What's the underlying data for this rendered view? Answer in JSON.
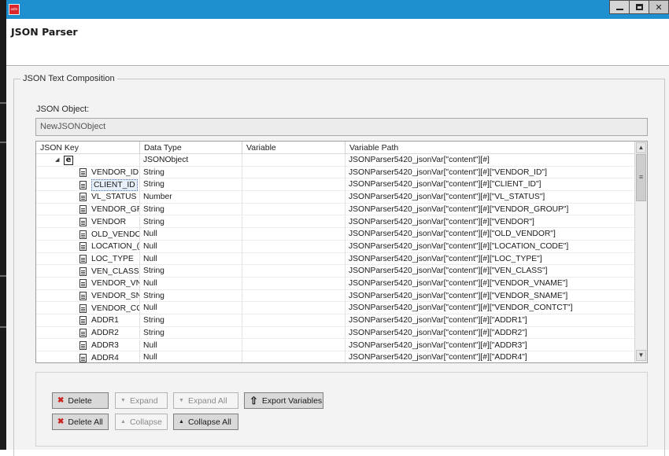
{
  "window": {
    "app_icon_text": "adm",
    "title": "JSON Parser",
    "controls": {
      "minimize": "▁",
      "maximize": "□",
      "close": ""
    }
  },
  "group": {
    "legend": "JSON Text Composition",
    "object_label": "JSON Object:",
    "object_value": "NewJSONObject"
  },
  "table": {
    "columns": [
      "JSON Key",
      "Data Type",
      "Variable",
      "Variable Path"
    ],
    "root": {
      "icon_text": "e",
      "expander": "◢",
      "type": "JSONObject",
      "variable": "",
      "path": "JSONParser5420_jsonVar[\"content\"][#]"
    },
    "rows": [
      {
        "key": "VENDOR_ID",
        "type": "String",
        "variable": "",
        "path": "JSONParser5420_jsonVar[\"content\"][#][\"VENDOR_ID\"]"
      },
      {
        "key": "CLIENT_ID",
        "type": "String",
        "variable": "",
        "path": "JSONParser5420_jsonVar[\"content\"][#][\"CLIENT_ID\"]"
      },
      {
        "key": "VL_STATUS",
        "type": "Number",
        "variable": "",
        "path": "JSONParser5420_jsonVar[\"content\"][#][\"VL_STATUS\"]"
      },
      {
        "key": "VENDOR_GR(",
        "type": "String",
        "variable": "",
        "path": "JSONParser5420_jsonVar[\"content\"][#][\"VENDOR_GROUP\"]"
      },
      {
        "key": "VENDOR",
        "type": "String",
        "variable": "",
        "path": "JSONParser5420_jsonVar[\"content\"][#][\"VENDOR\"]"
      },
      {
        "key": "OLD_VENDO",
        "type": "Null",
        "variable": "",
        "path": "JSONParser5420_jsonVar[\"content\"][#][\"OLD_VENDOR\"]"
      },
      {
        "key": "LOCATION_(",
        "type": "Null",
        "variable": "",
        "path": "JSONParser5420_jsonVar[\"content\"][#][\"LOCATION_CODE\"]"
      },
      {
        "key": "LOC_TYPE",
        "type": "Null",
        "variable": "",
        "path": "JSONParser5420_jsonVar[\"content\"][#][\"LOC_TYPE\"]"
      },
      {
        "key": "VEN_CLASS",
        "type": "String",
        "variable": "",
        "path": "JSONParser5420_jsonVar[\"content\"][#][\"VEN_CLASS\"]"
      },
      {
        "key": "VENDOR_VN",
        "type": "Null",
        "variable": "",
        "path": "JSONParser5420_jsonVar[\"content\"][#][\"VENDOR_VNAME\"]"
      },
      {
        "key": "VENDOR_SN",
        "type": "String",
        "variable": "",
        "path": "JSONParser5420_jsonVar[\"content\"][#][\"VENDOR_SNAME\"]"
      },
      {
        "key": "VENDOR_CO",
        "type": "Null",
        "variable": "",
        "path": "JSONParser5420_jsonVar[\"content\"][#][\"VENDOR_CONTCT\"]"
      },
      {
        "key": "ADDR1",
        "type": "String",
        "variable": "",
        "path": "JSONParser5420_jsonVar[\"content\"][#][\"ADDR1\"]"
      },
      {
        "key": "ADDR2",
        "type": "String",
        "variable": "",
        "path": "JSONParser5420_jsonVar[\"content\"][#][\"ADDR2\"]"
      },
      {
        "key": "ADDR3",
        "type": "Null",
        "variable": "",
        "path": "JSONParser5420_jsonVar[\"content\"][#][\"ADDR3\"]"
      },
      {
        "key": "ADDR4",
        "type": "Null",
        "variable": "",
        "path": "JSONParser5420_jsonVar[\"content\"][#][\"ADDR4\"]"
      }
    ],
    "selected_key": "CLIENT_ID"
  },
  "buttons": {
    "delete": {
      "label": "Delete",
      "icon": "✖",
      "enabled": true
    },
    "expand": {
      "label": "Expand",
      "icon": "▼",
      "enabled": false
    },
    "expand_all": {
      "label": "Expand All",
      "icon": "▼",
      "enabled": false
    },
    "export_variables": {
      "label": "Export Variables",
      "icon": "⇧",
      "enabled": true
    },
    "delete_all": {
      "label": "Delete All",
      "icon": "✖",
      "enabled": true
    },
    "collapse": {
      "label": "Collapse",
      "icon": "▲",
      "enabled": false
    },
    "collapse_all": {
      "label": "Collapse All",
      "icon": "▲",
      "enabled": true
    }
  },
  "colors": {
    "titlebar": "#1e8fcf",
    "delete_icon": "#c8231f"
  }
}
